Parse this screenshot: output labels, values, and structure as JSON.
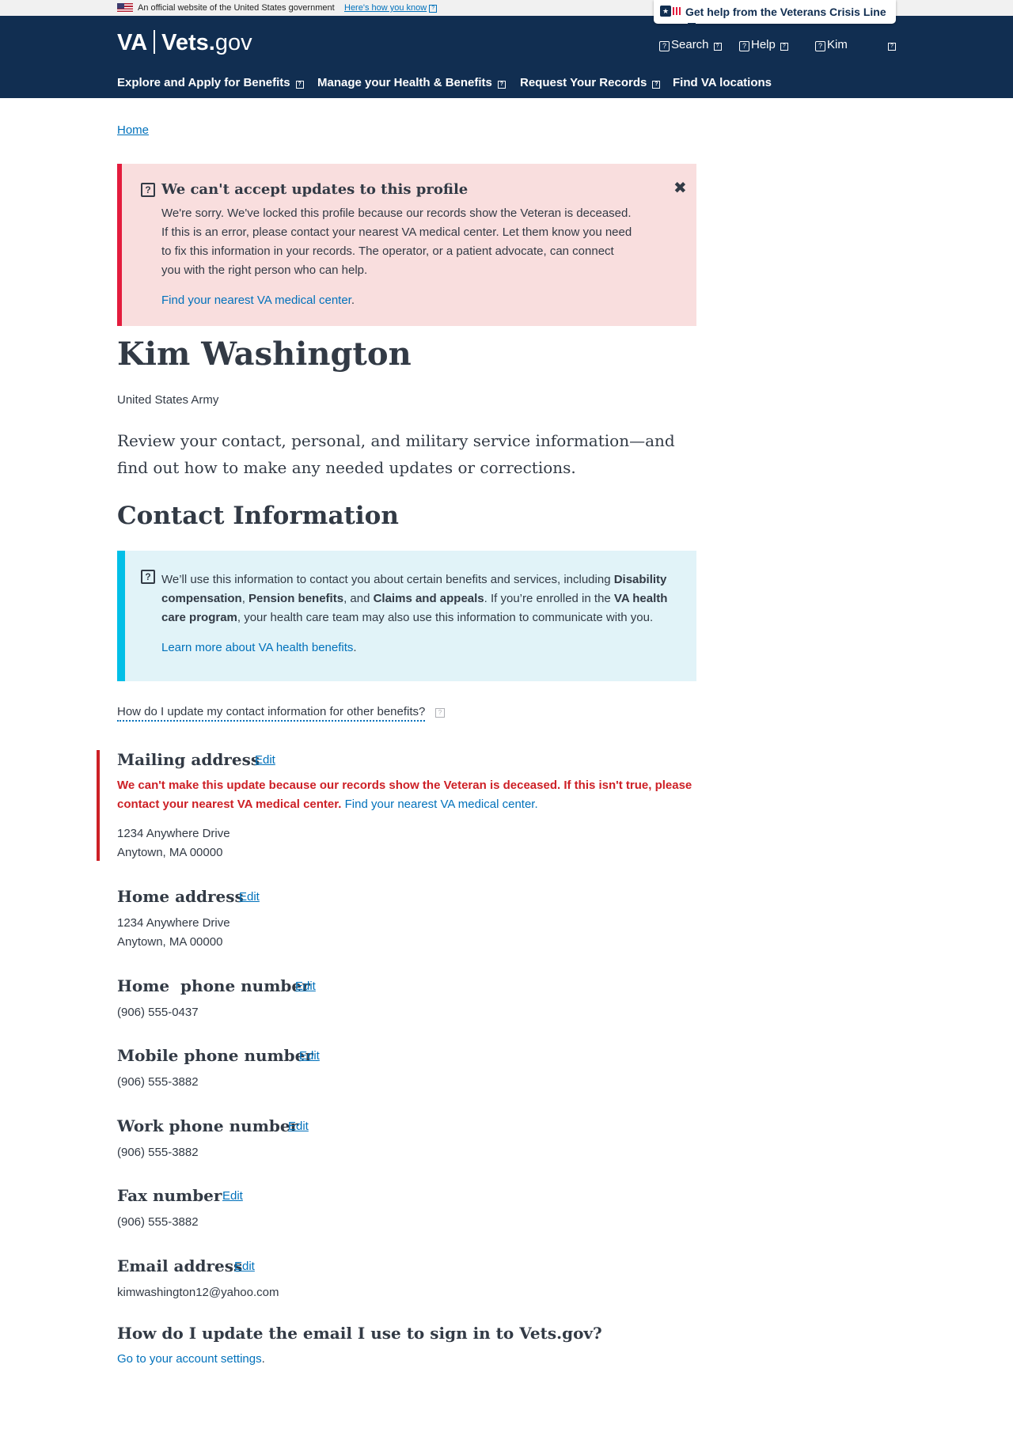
{
  "gov_banner": {
    "official_text": "An official website of the United States government",
    "how_you_know": "Here's how you know"
  },
  "crisis_line": {
    "label": "Get help from the Veterans Crisis Line"
  },
  "header": {
    "logo_va": "VA",
    "logo_vets": "Vets.",
    "logo_gov": "gov",
    "utility": {
      "search": "Search",
      "help": "Help",
      "user": "Kim"
    },
    "nav": [
      {
        "label": "Explore and Apply for Benefits"
      },
      {
        "label": "Manage your Health & Benefits"
      },
      {
        "label": "Request Your Records"
      },
      {
        "label": "Find VA locations"
      }
    ]
  },
  "breadcrumb": {
    "home": "Home"
  },
  "error_alert": {
    "title": "We can't accept updates to this profile",
    "body": "We're sorry. We've locked this profile because our records show the Veteran is deceased. If this is an error, please contact your nearest VA medical center. Let them know you need to fix this information in your records. The operator, or a patient advocate, can connect you with the right person who can help.",
    "link": "Find your nearest VA medical center",
    "link_suffix": "."
  },
  "profile": {
    "name": "Kim Washington",
    "branch": "United States Army",
    "intro": "Review your contact, personal, and military service information—and find out how to make any needed updates or corrections."
  },
  "contact": {
    "section_title": "Contact Information",
    "info": {
      "p1": "We’ll use this information to contact you about certain benefits and services, including ",
      "b1": "Disability compensation",
      "p2": ", ",
      "b2": "Pension benefits",
      "p3": ", and ",
      "b3": "Claims and appeals",
      "p4": ". If you’re enrolled in the ",
      "b4": "VA health care program",
      "p5": ", your health care team may also use this information to communicate with you.",
      "link": "Learn more about VA health benefits",
      "link_suffix": "."
    },
    "how_update": "How do I update my contact information for other benefits?",
    "edit_label": "Edit",
    "mailing": {
      "title": "Mailing address",
      "error": "We can't make this update because our records show the Veteran is deceased. If this isn't true, please contact your nearest VA medical center.",
      "error_link": "Find your nearest VA medical center.",
      "line1": "1234 Anywhere Drive",
      "line2": "Anytown, MA 00000"
    },
    "home": {
      "title": "Home address",
      "line1": "1234 Anywhere Drive",
      "line2": "Anytown, MA 00000"
    },
    "home_phone": {
      "title": "Home  phone number",
      "value": "(906) 555-0437"
    },
    "mobile_phone": {
      "title": "Mobile phone number",
      "value": "(906) 555-3882"
    },
    "work_phone": {
      "title": "Work phone number",
      "value": "(906) 555-3882"
    },
    "fax": {
      "title": "Fax number",
      "value": "(906) 555-3882"
    },
    "email": {
      "title": "Email address",
      "value": "kimwashington12@yahoo.com"
    },
    "signin": {
      "title": "How do I update the email I use to sign in to Vets.gov?",
      "link": "Go to your account settings",
      "link_suffix": "."
    }
  }
}
